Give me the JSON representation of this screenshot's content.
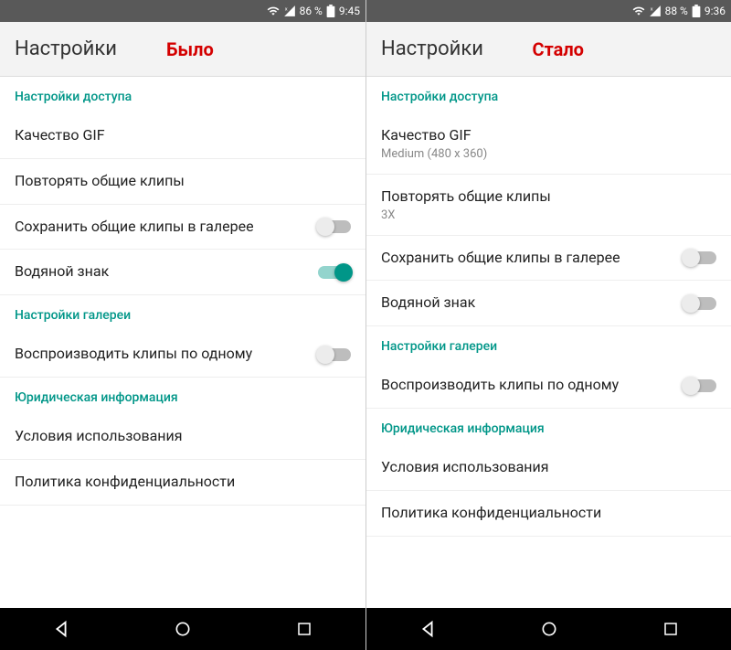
{
  "left": {
    "statusbar": {
      "battery": "86 %",
      "time": "9:45"
    },
    "header": {
      "title": "Настройки",
      "badge": "Было"
    },
    "sections": {
      "access": {
        "header": "Настройки доступа",
        "gif_quality": {
          "title": "Качество GIF"
        },
        "repeat_clips": {
          "title": "Повторять общие клипы"
        },
        "save_gallery": {
          "title": "Сохранить общие клипы в галерее",
          "on": false
        },
        "watermark": {
          "title": "Водяной знак",
          "on": true
        }
      },
      "gallery": {
        "header": "Настройки галереи",
        "play_one": {
          "title": "Воспроизводить клипы по одному",
          "on": false
        }
      },
      "legal": {
        "header": "Юридическая информация",
        "terms": {
          "title": "Условия использования"
        },
        "privacy": {
          "title": "Политика конфиденциальности"
        }
      }
    }
  },
  "right": {
    "statusbar": {
      "battery": "88 %",
      "time": "9:36"
    },
    "header": {
      "title": "Настройки",
      "badge": "Стало"
    },
    "sections": {
      "access": {
        "header": "Настройки доступа",
        "gif_quality": {
          "title": "Качество GIF",
          "sub": "Medium (480 x 360)"
        },
        "repeat_clips": {
          "title": "Повторять общие клипы",
          "sub": "3X"
        },
        "save_gallery": {
          "title": "Сохранить общие клипы в галерее",
          "on": false
        },
        "watermark": {
          "title": "Водяной знак",
          "on": false
        }
      },
      "gallery": {
        "header": "Настройки галереи",
        "play_one": {
          "title": "Воспроизводить клипы по одному",
          "on": false
        }
      },
      "legal": {
        "header": "Юридическая информация",
        "terms": {
          "title": "Условия использования"
        },
        "privacy": {
          "title": "Политика конфиденциальности"
        }
      }
    }
  }
}
